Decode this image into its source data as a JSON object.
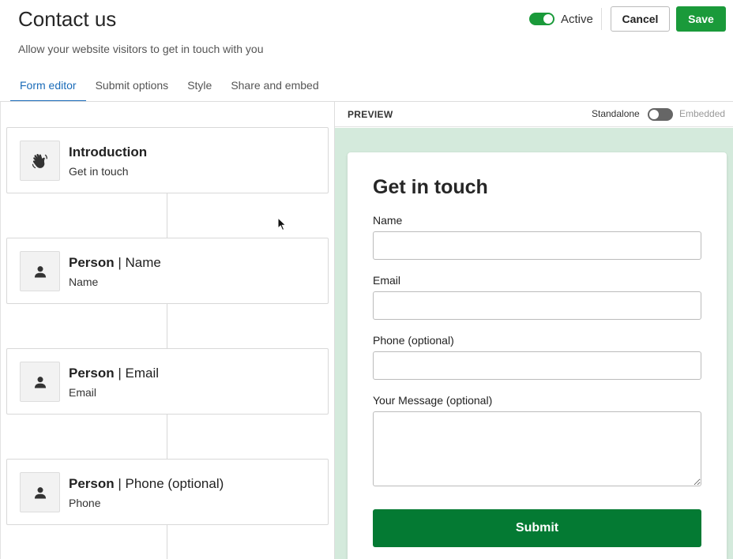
{
  "header": {
    "title": "Contact us",
    "subtitle": "Allow your website visitors to get in touch with you",
    "active_label": "Active",
    "active_on": true,
    "cancel_label": "Cancel",
    "save_label": "Save"
  },
  "tabs": [
    {
      "label": "Form editor",
      "active": true
    },
    {
      "label": "Submit options",
      "active": false
    },
    {
      "label": "Style",
      "active": false
    },
    {
      "label": "Share and embed",
      "active": false
    }
  ],
  "cards": [
    {
      "title_bold": "Introduction",
      "title_rest": "",
      "subtitle": "Get in touch",
      "icon": "wave-hand-icon"
    },
    {
      "title_bold": "Person",
      "title_rest": " | Name",
      "subtitle": "Name",
      "icon": "person-icon"
    },
    {
      "title_bold": "Person",
      "title_rest": " | Email",
      "subtitle": "Email",
      "icon": "person-icon"
    },
    {
      "title_bold": "Person",
      "title_rest": " | Phone (optional)",
      "subtitle": "Phone",
      "icon": "person-icon"
    }
  ],
  "preview": {
    "label": "PREVIEW",
    "standalone_label": "Standalone",
    "embedded_label": "Embedded",
    "form": {
      "title": "Get in touch",
      "fields": [
        {
          "label": "Name",
          "value": ""
        },
        {
          "label": "Email",
          "value": ""
        },
        {
          "label": "Phone (optional)",
          "value": ""
        },
        {
          "label": "Your Message (optional)",
          "value": ""
        }
      ],
      "submit_label": "Submit"
    }
  },
  "colors": {
    "accent_green": "#1a9a3a",
    "submit_green": "#047a33",
    "tab_blue": "#1a6bb8",
    "preview_bg": "#d4eadc"
  }
}
